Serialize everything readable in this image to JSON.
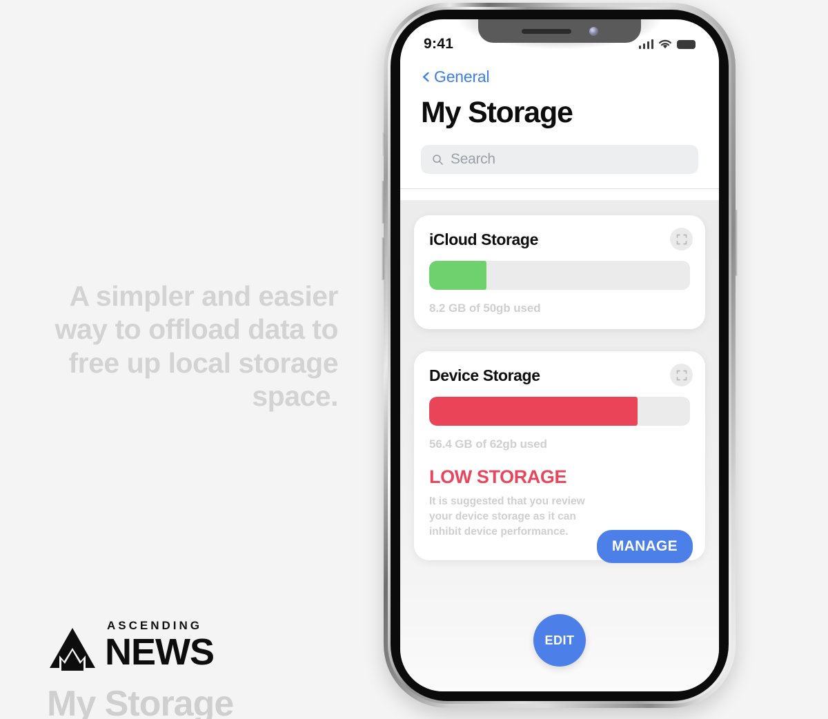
{
  "promo": {
    "tagline": "A simpler and easier way to offload data to free up local storage space.",
    "brand_top": "ASCENDING",
    "brand_main": "NEWS",
    "watermark_title": "My Storage",
    "logo_icon": "mountain-triangle-icon"
  },
  "phone": {
    "status_bar": {
      "time": "9:41",
      "signal_icon": "cellular-signal-icon",
      "wifi_icon": "wifi-icon",
      "battery_icon": "battery-full-icon"
    },
    "nav": {
      "back_icon": "chevron-left-icon",
      "back_label": "General",
      "title": "My Storage"
    },
    "search": {
      "icon": "search-icon",
      "placeholder": "Search",
      "value": ""
    },
    "cards": [
      {
        "title": "iCloud Storage",
        "expand_icon": "expand-icon",
        "usage_text": "8.2 GB of 50gb used",
        "percent": 22,
        "bar_color": "#6ed16e"
      },
      {
        "title": "Device Storage",
        "expand_icon": "expand-icon",
        "usage_text": "56.4 GB of 62gb used",
        "percent": 80,
        "bar_color": "#ea4459",
        "warning_title": "LOW STORAGE",
        "warning_body": "It is suggested that you review your device storage as it can inhibit device performance.",
        "action_label": "MANAGE"
      }
    ],
    "edit_button_label": "EDIT",
    "home_indicator": "home-indicator"
  },
  "colors": {
    "accent_blue": "#4d7fe8",
    "green": "#6ed16e",
    "red": "#ea4459",
    "page_background": "#f4f4f4"
  }
}
